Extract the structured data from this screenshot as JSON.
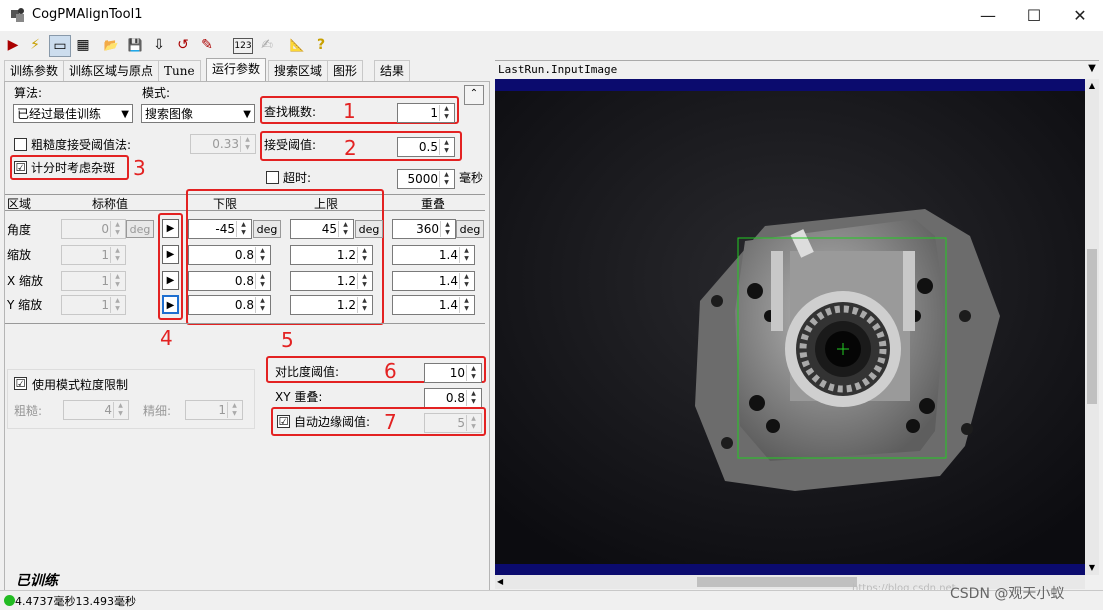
{
  "window": {
    "title": "CogPMAlignTool1",
    "minimize": "—",
    "maximize": "☐",
    "close": "✕"
  },
  "toolbar": {
    "icons": [
      "run-icon",
      "lightning-icon",
      "display-icon",
      "grid-icon",
      "open-folder-icon",
      "save-icon",
      "import-icon",
      "reset-icon",
      "brush-icon",
      "counter-icon",
      "edit-icon",
      "ruler-icon",
      "help-icon"
    ],
    "glyphs": [
      "▶",
      "⚡",
      "▭",
      "▦",
      "📂",
      "💾",
      "⇩",
      "↺",
      "✎",
      "123",
      "✍",
      "📐",
      "?"
    ]
  },
  "tabs": [
    "训练参数",
    "训练区域与原点",
    "Tune",
    "运行参数",
    "搜索区域",
    "图形",
    "结果"
  ],
  "active_tab": 3,
  "params": {
    "algorithm_label": "算法:",
    "algorithm_value": "已经过最佳训练",
    "mode_label": "模式:",
    "mode_value": "搜索图像",
    "find_count_label": "查找概数:",
    "find_count_value": "1",
    "accept_label": "接受阈值:",
    "accept_value": "0.5",
    "coarse_label": "粗糙度接受阈值法:",
    "coarse_value": "0.33",
    "timeout_label": "超时:",
    "timeout_value": "5000",
    "timeout_unit": "毫秒",
    "clutter_label": "计分时考虑杂斑",
    "clutter_checked": "☑"
  },
  "table": {
    "headers": [
      "区域",
      "标称值",
      "下限",
      "上限",
      "重叠"
    ],
    "rows": [
      {
        "name": "角度",
        "nominal": "0",
        "nominal_unit": "deg",
        "low": "-45",
        "low_unit": "deg",
        "high": "45",
        "high_unit": "deg",
        "overlap": "360",
        "overlap_unit": "deg"
      },
      {
        "name": "缩放",
        "nominal": "1",
        "low": "0.8",
        "high": "1.2",
        "overlap": "1.4"
      },
      {
        "name": "X 缩放",
        "nominal": "1",
        "low": "0.8",
        "high": "1.2",
        "overlap": "1.4"
      },
      {
        "name": "Y 缩放",
        "nominal": "1",
        "low": "0.8",
        "high": "1.2",
        "overlap": "1.4"
      }
    ]
  },
  "lower": {
    "contrast_label": "对比度阈值:",
    "contrast_value": "10",
    "xy_overlap_label": "XY 重叠:",
    "xy_overlap_value": "0.8",
    "auto_edge_label": "自动边缘阈值:",
    "auto_edge_value": "5",
    "granularity_label": "使用模式粒度限制",
    "coarse_label": "粗糙:",
    "coarse_value": "4",
    "fine_label": "精细:",
    "fine_value": "1",
    "trained_status": "已训练"
  },
  "annotations": [
    "1",
    "2",
    "3",
    "4",
    "5",
    "6",
    "7"
  ],
  "image": {
    "title": "LastRun.InputImage"
  },
  "status": {
    "text": "4.4737毫秒13.493毫秒",
    "watermark": "CSDN @观天小蚁",
    "watermark_faint": "https://blog.csdn.net"
  },
  "colors": {
    "annotation_red": "#e32222",
    "roi_green": "#22cc22",
    "navy": "#0b0b6e",
    "status_green": "#22bb22"
  }
}
